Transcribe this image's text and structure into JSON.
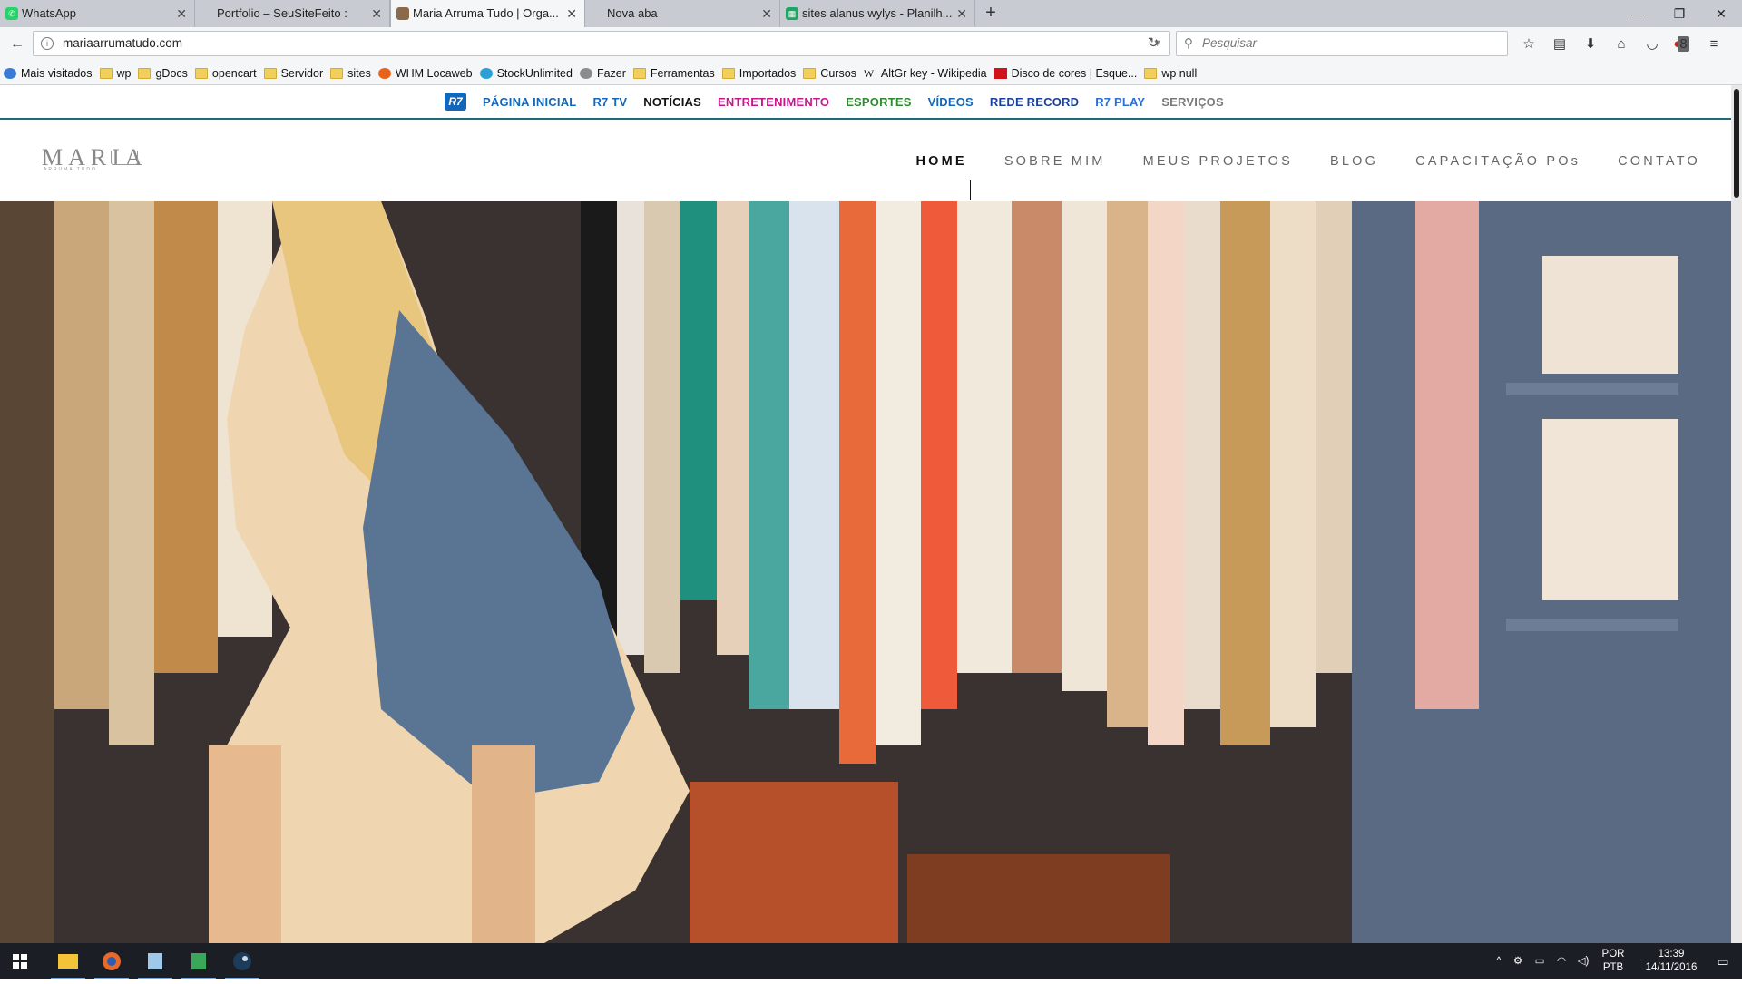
{
  "browser": {
    "tabs": [
      {
        "title": "WhatsApp",
        "icon": "whatsapp-icon",
        "color": "#25d366",
        "active": false
      },
      {
        "title": "Portfolio – SeuSiteFeito :",
        "icon": "page-icon",
        "color": "#ffffff",
        "active": false
      },
      {
        "title": "Maria Arruma Tudo | Orga...",
        "icon": "site-favicon",
        "color": "#8a6a4a",
        "active": true
      },
      {
        "title": "Nova aba",
        "icon": "page-icon",
        "color": "#ffffff",
        "active": false
      },
      {
        "title": "sites alanus wylys - Planilh...",
        "icon": "sheets-icon",
        "color": "#1fa463",
        "active": false
      }
    ],
    "url": "mariaarrumatudo.com",
    "search_placeholder": "Pesquisar",
    "extension_badge": "8",
    "bookmarks": [
      {
        "label": "Mais visitados",
        "icon": "gear-icon"
      },
      {
        "label": "wp",
        "icon": "folder-icon"
      },
      {
        "label": "gDocs",
        "icon": "folder-icon"
      },
      {
        "label": "opencart",
        "icon": "folder-icon"
      },
      {
        "label": "Servidor",
        "icon": "folder-icon"
      },
      {
        "label": "sites",
        "icon": "folder-icon"
      },
      {
        "label": "WHM Locaweb",
        "icon": "cpanel-icon"
      },
      {
        "label": "StockUnlimited",
        "icon": "link-icon"
      },
      {
        "label": "Fazer",
        "icon": "globe-icon"
      },
      {
        "label": "Ferramentas",
        "icon": "folder-icon"
      },
      {
        "label": "Importados",
        "icon": "folder-icon"
      },
      {
        "label": "Cursos",
        "icon": "folder-icon"
      },
      {
        "label": "AltGr key - Wikipedia",
        "icon": "wikipedia-icon"
      },
      {
        "label": "Disco de cores | Esque...",
        "icon": "adobe-icon"
      },
      {
        "label": "wp null",
        "icon": "folder-icon"
      }
    ]
  },
  "r7": {
    "logo": "R7",
    "items": [
      {
        "label": "PÁGINA INICIAL",
        "color": "#1466b8"
      },
      {
        "label": "R7 TV",
        "color": "#1466b8"
      },
      {
        "label": "NOTÍCIAS",
        "color": "#111111"
      },
      {
        "label": "ENTRETENIMENTO",
        "color": "#c2188a"
      },
      {
        "label": "ESPORTES",
        "color": "#2d8a2d"
      },
      {
        "label": "VÍDEOS",
        "color": "#1466b8"
      },
      {
        "label": "REDE RECORD",
        "color": "#1a3f9e"
      },
      {
        "label": "R7 PLAY",
        "color": "#2a6fd6"
      },
      {
        "label": "SERVIÇOS",
        "color": "#7a7a7a"
      }
    ]
  },
  "site": {
    "logo_text": "MARIA",
    "logo_subtext": "ARRUMA TUDO",
    "nav": [
      "HOME",
      "SOBRE MIM",
      "MEUS PROJETOS",
      "BLOG",
      "CAPACITAÇÃO POs",
      "CONTATO"
    ],
    "active_nav": "HOME"
  },
  "taskbar": {
    "lang_top": "POR",
    "lang_bottom": "PTB",
    "time": "13:39",
    "date": "14/11/2016"
  },
  "colors": {
    "accent_teal": "#1e6b74",
    "taskbar": "#1b1e24"
  }
}
